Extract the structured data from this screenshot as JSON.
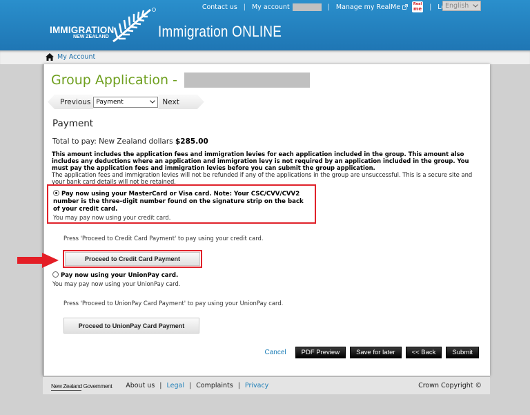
{
  "header": {
    "logo_line1": "IMMIGRATION",
    "logo_line2": "NEW ZEALAND",
    "app_title": "Immigration ONLINE",
    "top_links": {
      "contact": "Contact us",
      "my_account": "My account",
      "realme": "Manage my RealMe",
      "realme_badge_top": "Real",
      "realme_badge_bottom": "me",
      "logout": "Logout",
      "separator": "|"
    },
    "language": {
      "selected": "English"
    }
  },
  "breadcrumb": {
    "home_label": "My Account"
  },
  "page": {
    "title": "Group Application -",
    "nav": {
      "previous": "Previous",
      "step_selected": "Payment",
      "next": "Next"
    },
    "section_heading": "Payment",
    "total_label": "Total to pay: New Zealand dollars",
    "total_amount": "$285.00",
    "notes_bold": "This amount includes the application fees and immigration levies for each application included in the group. This amount also includes any deductions where an application and immigration levy is not required by an application included in the group. You must pay the application fees and immigration levies before you can submit the group application.",
    "notes_normal": "The application fees and immigration levies will not be refunded if any of the applications in the group are unsuccessful. This is a secure site and your bank card details will not be retained.",
    "options": [
      {
        "title": "Pay now using your MasterCard or Visa card. Note: Your CSC/CVV/CVV2 number is the three-digit number found on the signature strip on the back of your credit card.",
        "subtitle": "You may pay now using your credit card.",
        "selected": true,
        "instruction": "Press 'Proceed to Credit Card Payment' to pay using your credit card.",
        "button": "Proceed to Credit Card Payment"
      },
      {
        "title": "Pay now using your UnionPay card.",
        "subtitle": "You may pay now using your UnionPay card.",
        "selected": false,
        "instruction": "Press 'Proceed to UnionPay Card Payment' to pay using your UnionPay card.",
        "button": "Proceed to UnionPay Card Payment"
      }
    ],
    "actions": {
      "cancel": "Cancel",
      "pdf_preview": "PDF Preview",
      "save_for_later": "Save for later",
      "back": "<< Back",
      "submit": "Submit"
    }
  },
  "footer": {
    "gov_logo": "New Zealand Government",
    "links": [
      "About us",
      "Legal",
      "Complaints",
      "Privacy"
    ],
    "separator": "|",
    "copyright": "Crown Copyright ©"
  },
  "colors": {
    "header_blue": "#1f76b4",
    "title_green": "#6e9f1e",
    "highlight_red": "#e0222a",
    "link_blue": "#1e7fb8"
  }
}
